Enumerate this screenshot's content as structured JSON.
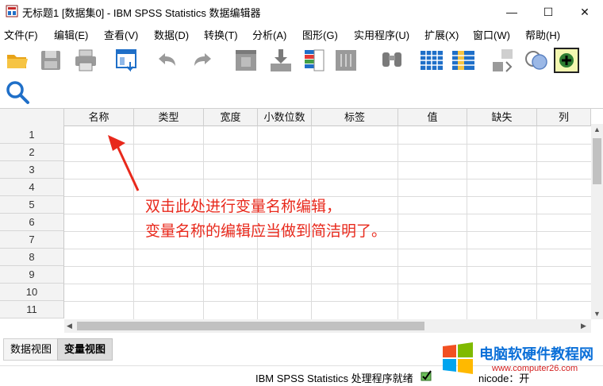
{
  "window": {
    "title": "无标题1 [数据集0] - IBM SPSS Statistics 数据编辑器",
    "minimize": "—",
    "maximize": "☐",
    "close": "✕"
  },
  "menu": [
    "文件(F)",
    "编辑(E)",
    "查看(V)",
    "数据(D)",
    "转换(T)",
    "分析(A)",
    "图形(G)",
    "实用程序(U)",
    "扩展(X)",
    "窗口(W)",
    "帮助(H)"
  ],
  "toolbar": {
    "icons": [
      "open-folder-icon",
      "save-icon",
      "print-icon",
      "recall-dialog-icon",
      "undo-icon",
      "redo-icon",
      "goto-case-icon",
      "goto-variable-icon",
      "variables-icon",
      "run-descriptives-icon",
      "find-icon",
      "insert-cases-icon",
      "insert-variable-icon",
      "split-file-icon",
      "weight-cases-icon",
      "select-cases-icon",
      "value-labels-icon",
      "use-variable-sets-icon",
      "search-icon"
    ]
  },
  "grid": {
    "columns": [
      "名称",
      "类型",
      "宽度",
      "小数位数",
      "标签",
      "值",
      "缺失",
      "列"
    ],
    "rows": [
      "1",
      "2",
      "3",
      "4",
      "5",
      "6",
      "7",
      "8",
      "9",
      "10",
      "11"
    ]
  },
  "annotation": {
    "line1": "双击此处进行变量名称编辑，",
    "line2": "变量名称的编辑应当做到简洁明了。",
    "color": "#e8291c"
  },
  "tabs": {
    "data_view": "数据视图",
    "variable_view": "变量视图"
  },
  "status": {
    "processor": "IBM SPSS Statistics 处理程序就绪",
    "unicode": "nicode：开"
  },
  "watermark": {
    "title": "电脑软硬件教程网",
    "url": "www.computer26.com"
  },
  "colors": {
    "accent_blue": "#1f6fc8",
    "arrow_red": "#e8291c"
  }
}
